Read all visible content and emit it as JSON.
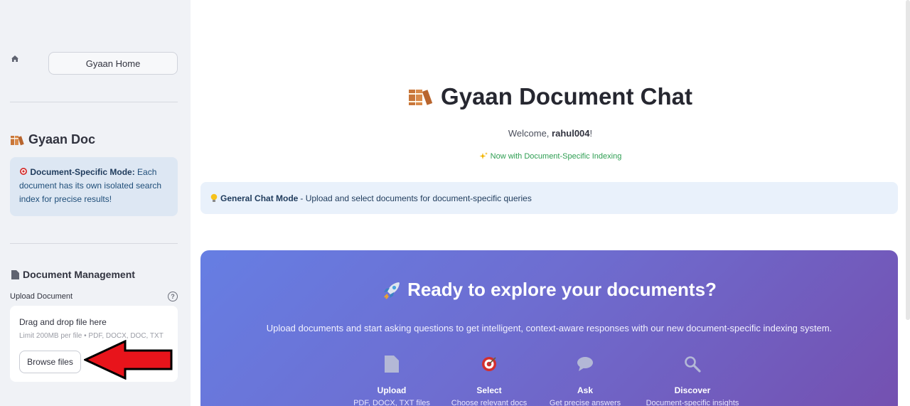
{
  "sidebar": {
    "home_label": "Gyaan Home",
    "brand_title": "Gyaan Doc",
    "info": {
      "bold": "Document-Specific Mode:",
      "text": " Each document has its own isolated search index for precise results!"
    },
    "doc_management_title": "Document Management",
    "upload_label": "Upload Document",
    "dropzone_main": "Drag and drop file here",
    "dropzone_sub": "Limit 200MB per file • PDF, DOCX, DOC, TXT",
    "browse_label": "Browse files"
  },
  "main": {
    "title": "Gyaan Document Chat",
    "welcome_prefix": "Welcome, ",
    "username": "rahul004",
    "welcome_suffix": "!",
    "indexing_note": "Now with Document-Specific Indexing",
    "mode_bold": "General Chat Mode",
    "mode_text": "- Upload and select documents for document-specific queries"
  },
  "hero": {
    "title": "Ready to explore your documents?",
    "description": "Upload documents and start asking questions to get intelligent, context-aware responses with our new document-specific indexing system.",
    "steps": [
      {
        "label": "Upload",
        "sub": "PDF, DOCX, TXT files",
        "icon": "document-icon"
      },
      {
        "label": "Select",
        "sub": "Choose relevant docs",
        "icon": "target-icon"
      },
      {
        "label": "Ask",
        "sub": "Get precise answers",
        "icon": "speech-bubble-icon"
      },
      {
        "label": "Discover",
        "sub": "Document-specific insights",
        "icon": "magnifier-icon"
      }
    ]
  },
  "colors": {
    "sidebar_bg": "#f0f2f6",
    "info_bg": "#dde7f3",
    "mode_bar_bg": "#e9f1fb",
    "hero_gradient_start": "#667ee3",
    "hero_gradient_end": "#7450b0",
    "indexing_green": "#2e9e52",
    "arrow_red": "#e8141b"
  }
}
